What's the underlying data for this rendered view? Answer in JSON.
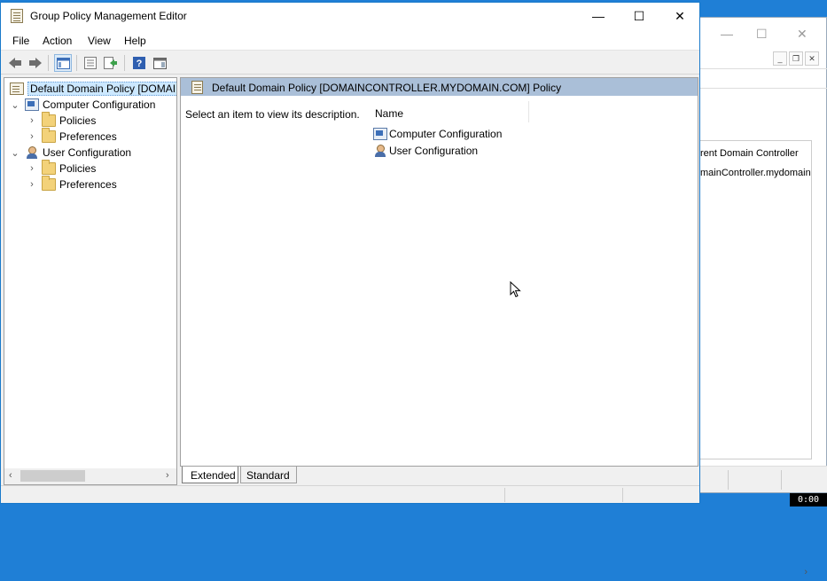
{
  "window": {
    "title": "Group Policy Management Editor",
    "controls": {
      "minimize": "—",
      "maximize": "☐",
      "close": "✕"
    }
  },
  "menu": [
    "File",
    "Action",
    "View",
    "Help"
  ],
  "toolbar": {
    "items": [
      "back-icon",
      "forward-icon",
      "show-hide-console-tree-icon",
      "properties-icon",
      "export-list-icon",
      "help-icon",
      "show-action-pane-icon"
    ]
  },
  "tree": {
    "root": "Default Domain Policy [DOMAINCONTROLLER.MYDOMAIN.COM] Policy",
    "computer": "Computer Configuration",
    "computer_children": [
      "Policies",
      "Preferences"
    ],
    "user": "User Configuration",
    "user_children": [
      "Policies",
      "Preferences"
    ]
  },
  "details": {
    "header": "Default Domain Policy [DOMAINCONTROLLER.MYDOMAIN.COM] Policy",
    "description": "Select an item to view its description.",
    "column": "Name",
    "rows": [
      "Computer Configuration",
      "User Configuration"
    ]
  },
  "tabs": [
    "Extended",
    "Standard"
  ],
  "background_window": {
    "lines": [
      "rent Domain Controller",
      "mainController.mydomain.co"
    ]
  },
  "clock": "0:00"
}
